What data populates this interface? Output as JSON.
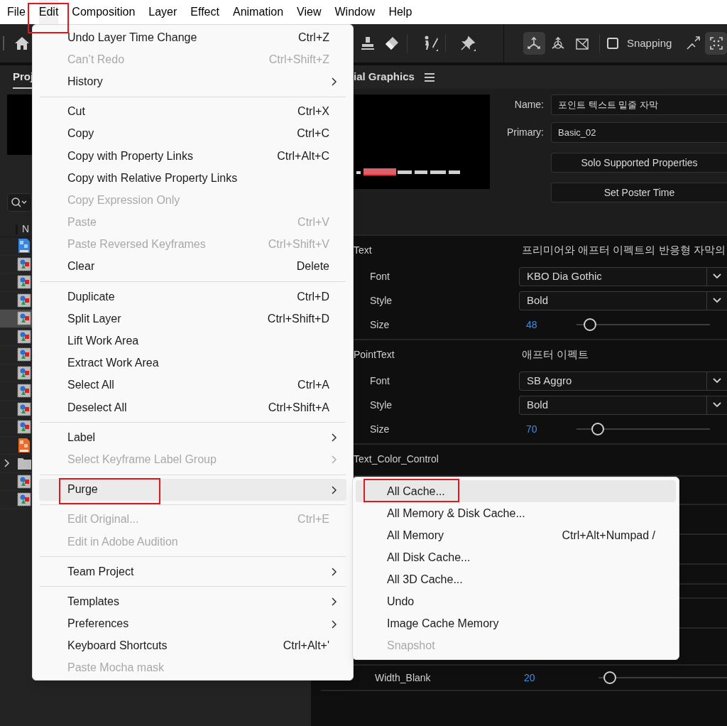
{
  "menubar": [
    {
      "label": "File",
      "selected": false,
      "annotated": false
    },
    {
      "label": "Edit",
      "selected": true,
      "annotated": true
    },
    {
      "label": "Composition",
      "selected": false,
      "annotated": false
    },
    {
      "label": "Layer",
      "selected": false,
      "annotated": false
    },
    {
      "label": "Effect",
      "selected": false,
      "annotated": false
    },
    {
      "label": "Animation",
      "selected": false,
      "annotated": false
    },
    {
      "label": "View",
      "selected": false,
      "annotated": false
    },
    {
      "label": "Window",
      "selected": false,
      "annotated": false
    },
    {
      "label": "Help",
      "selected": false,
      "annotated": false
    }
  ],
  "toolbar": {
    "tools": [
      {
        "kind": "stamp"
      },
      {
        "kind": "eraser"
      },
      {
        "kind": "puppet"
      },
      {
        "kind": "pin"
      }
    ],
    "view_buttons": [
      {
        "kind": "local-axis",
        "selected": true
      },
      {
        "kind": "world-axis",
        "selected": false
      },
      {
        "kind": "view-axis",
        "selected": false
      }
    ],
    "snapping": {
      "label": "Snapping",
      "checked": false
    },
    "extra_buttons": [
      {
        "kind": "expand",
        "selected": false
      },
      {
        "kind": "snap-frame",
        "selected": true
      }
    ]
  },
  "project_panel": {
    "tab": {
      "label": "Proj",
      "selected": true
    },
    "column": "N",
    "rows": [
      {
        "kind": "psd",
        "selected": false
      },
      {
        "kind": "comp",
        "selected": false
      },
      {
        "kind": "comp",
        "selected": false
      },
      {
        "kind": "comp",
        "selected": false
      },
      {
        "kind": "comp",
        "selected": true
      },
      {
        "kind": "comp",
        "selected": false
      },
      {
        "kind": "comp",
        "selected": false
      },
      {
        "kind": "comp",
        "selected": false
      },
      {
        "kind": "comp",
        "selected": false
      },
      {
        "kind": "comp",
        "selected": false
      },
      {
        "kind": "comp",
        "selected": false
      },
      {
        "kind": "jpg",
        "selected": false
      },
      {
        "kind": "folder",
        "selected": false
      },
      {
        "kind": "comp",
        "selected": false
      },
      {
        "kind": "comp",
        "selected": false
      }
    ]
  },
  "graphics_panel": {
    "title": "ial Graphics",
    "fields": [
      {
        "label": "Name:",
        "value": "포인트 텍스트 밑줄 자막"
      },
      {
        "label": "Primary:",
        "value": "Basic_02"
      }
    ],
    "buttons": [
      "Solo Supported Properties",
      "Set Poster Time"
    ],
    "groups": [
      {
        "name": "Text",
        "value": "프리미어와 애프터 이펙트의 반응형 자막의",
        "props": [
          {
            "kind": "dropdown",
            "label": "Font",
            "value": "KBO Dia Gothic"
          },
          {
            "kind": "dropdown",
            "label": "Style",
            "value": "Bold"
          },
          {
            "kind": "slider",
            "label": "Size",
            "value": "48",
            "level": 0.1
          }
        ]
      },
      {
        "name": "PointText",
        "value": "애프터 이펙트",
        "props": [
          {
            "kind": "dropdown",
            "label": "Font",
            "value": "SB Aggro"
          },
          {
            "kind": "dropdown",
            "label": "Style",
            "value": "Bold"
          },
          {
            "kind": "slider",
            "label": "Size",
            "value": "70",
            "level": 0.16
          }
        ]
      },
      {
        "name": "Text_Color_Control"
      }
    ],
    "lower_props": [
      {
        "kind": "slider",
        "label": "Width_Blank",
        "value": "20",
        "level": 0.09
      }
    ]
  },
  "edit_menu": {
    "sections": [
      [
        {
          "label": "Undo Layer Time Change",
          "shortcut": "Ctrl+Z",
          "disabled": false,
          "submenu": false,
          "selected": false,
          "annotated": false
        },
        {
          "label": "Can’t Redo",
          "shortcut": "Ctrl+Shift+Z",
          "disabled": true,
          "submenu": false,
          "selected": false,
          "annotated": false
        },
        {
          "label": "History",
          "disabled": false,
          "submenu": true,
          "selected": false,
          "annotated": false
        }
      ],
      [
        {
          "label": "Cut",
          "shortcut": "Ctrl+X",
          "disabled": false,
          "submenu": false,
          "selected": false,
          "annotated": false
        },
        {
          "label": "Copy",
          "shortcut": "Ctrl+C",
          "disabled": false,
          "submenu": false,
          "selected": false,
          "annotated": false
        },
        {
          "label": "Copy with Property Links",
          "shortcut": "Ctrl+Alt+C",
          "disabled": false,
          "submenu": false,
          "selected": false,
          "annotated": false
        },
        {
          "label": "Copy with Relative Property Links",
          "disabled": false,
          "submenu": false,
          "selected": false,
          "annotated": false
        },
        {
          "label": "Copy Expression Only",
          "disabled": true,
          "submenu": false,
          "selected": false,
          "annotated": false
        },
        {
          "label": "Paste",
          "shortcut": "Ctrl+V",
          "disabled": true,
          "submenu": false,
          "selected": false,
          "annotated": false
        },
        {
          "label": "Paste Reversed Keyframes",
          "shortcut": "Ctrl+Shift+V",
          "disabled": true,
          "submenu": false,
          "selected": false,
          "annotated": false
        },
        {
          "label": "Clear",
          "shortcut": "Delete",
          "disabled": false,
          "submenu": false,
          "selected": false,
          "annotated": false
        }
      ],
      [
        {
          "label": "Duplicate",
          "shortcut": "Ctrl+D",
          "disabled": false,
          "submenu": false,
          "selected": false,
          "annotated": false
        },
        {
          "label": "Split Layer",
          "shortcut": "Ctrl+Shift+D",
          "disabled": false,
          "submenu": false,
          "selected": false,
          "annotated": false
        },
        {
          "label": "Lift Work Area",
          "disabled": false,
          "submenu": false,
          "selected": false,
          "annotated": false
        },
        {
          "label": "Extract Work Area",
          "disabled": false,
          "submenu": false,
          "selected": false,
          "annotated": false
        },
        {
          "label": "Select All",
          "shortcut": "Ctrl+A",
          "disabled": false,
          "submenu": false,
          "selected": false,
          "annotated": false
        },
        {
          "label": "Deselect All",
          "shortcut": "Ctrl+Shift+A",
          "disabled": false,
          "submenu": false,
          "selected": false,
          "annotated": false
        }
      ],
      [
        {
          "label": "Label",
          "disabled": false,
          "submenu": true,
          "selected": false,
          "annotated": false
        },
        {
          "label": "Select Keyframe Label Group",
          "disabled": true,
          "submenu": true,
          "selected": false,
          "annotated": false
        }
      ],
      [
        {
          "label": "Purge",
          "disabled": false,
          "submenu": true,
          "selected": true,
          "annotated": true
        }
      ],
      [
        {
          "label": "Edit Original...",
          "shortcut": "Ctrl+E",
          "disabled": true,
          "submenu": false,
          "selected": false,
          "annotated": false
        },
        {
          "label": "Edit in Adobe Audition",
          "disabled": true,
          "submenu": false,
          "selected": false,
          "annotated": false
        }
      ],
      [
        {
          "label": "Team Project",
          "disabled": false,
          "submenu": true,
          "selected": false,
          "annotated": false
        }
      ],
      [
        {
          "label": "Templates",
          "disabled": false,
          "submenu": true,
          "selected": false,
          "annotated": false
        },
        {
          "label": "Preferences",
          "disabled": false,
          "submenu": true,
          "selected": false,
          "annotated": false
        },
        {
          "label": "Keyboard Shortcuts",
          "shortcut": "Ctrl+Alt+'",
          "disabled": false,
          "submenu": false,
          "selected": false,
          "annotated": false
        },
        {
          "label": "Paste Mocha mask",
          "disabled": true,
          "submenu": false,
          "selected": false,
          "annotated": false
        }
      ]
    ]
  },
  "purge_menu": {
    "items": [
      {
        "label": "All Cache...",
        "disabled": false,
        "selected": true,
        "annotated": true
      },
      {
        "label": "All Memory & Disk Cache...",
        "disabled": false,
        "selected": false,
        "annotated": false
      },
      {
        "label": "All Memory",
        "shortcut": "Ctrl+Alt+Numpad /",
        "disabled": false,
        "selected": false,
        "annotated": false
      },
      {
        "label": "All Disk Cache...",
        "disabled": false,
        "selected": false,
        "annotated": false
      },
      {
        "label": "All 3D Cache...",
        "disabled": false,
        "selected": false,
        "annotated": false
      },
      {
        "label": "Undo",
        "disabled": false,
        "selected": false,
        "annotated": false
      },
      {
        "label": "Image Cache Memory",
        "disabled": false,
        "selected": false,
        "annotated": false
      },
      {
        "label": "Snapshot",
        "disabled": true,
        "selected": false,
        "annotated": false
      }
    ]
  }
}
